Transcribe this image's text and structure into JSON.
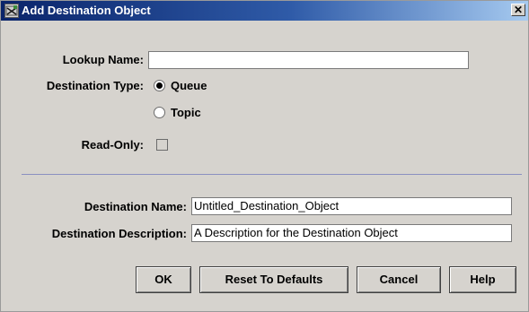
{
  "window": {
    "title": "Add Destination Object",
    "close_label": "✕"
  },
  "form": {
    "lookup_name": {
      "label": "Lookup Name:",
      "value": ""
    },
    "destination_type": {
      "label": "Destination Type:",
      "options": [
        {
          "label": "Queue",
          "selected": true
        },
        {
          "label": "Topic",
          "selected": false
        }
      ]
    },
    "read_only": {
      "label": "Read-Only:",
      "checked": false
    },
    "destination_name": {
      "label": "Destination Name:",
      "value": "Untitled_Destination_Object"
    },
    "destination_description": {
      "label": "Destination Description:",
      "value": "A Description for the Destination Object"
    }
  },
  "buttons": {
    "ok": "OK",
    "reset": "Reset To Defaults",
    "cancel": "Cancel",
    "help": "Help"
  },
  "colors": {
    "titlebar_start": "#0a246a",
    "titlebar_end": "#a6caf0",
    "dialog_bg": "#d6d3ce",
    "divider": "#8a8fc0"
  }
}
